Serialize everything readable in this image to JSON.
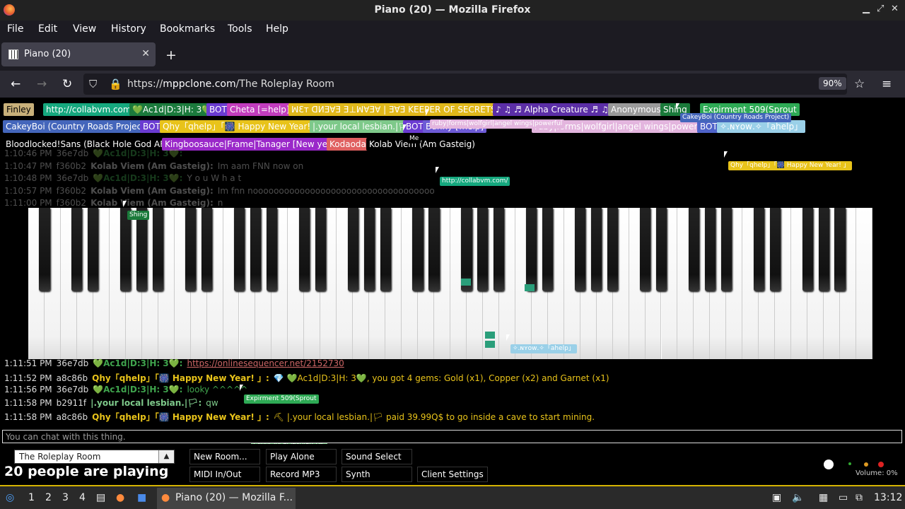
{
  "window": {
    "title": "Piano (20) — Mozilla Firefox"
  },
  "menu": [
    "File",
    "Edit",
    "View",
    "History",
    "Bookmarks",
    "Tools",
    "Help"
  ],
  "tab": {
    "label": "Piano (20)"
  },
  "nav": {
    "url_prefix": "https://",
    "url_host": "mppclone.com",
    "url_path": "/The Roleplay Room",
    "zoom": "90%"
  },
  "users_row1": [
    {
      "label": "Finley",
      "bg": "#c8b07a",
      "fg": "#000"
    },
    {
      "label": "http://collabvm.com/",
      "bg": "#15a87e",
      "fg": "#fff"
    },
    {
      "label": "💚Ac1d|D:3|H: 3💚",
      "bg": "#1b7a3c",
      "fg": "#fff"
    },
    {
      "label": "BOT",
      "bg": "#6a3bd1",
      "fg": "#fff"
    },
    {
      "label": "Cheta [=help]",
      "bg": "#c23cbd",
      "fg": "#fff"
    },
    {
      "label": "ꟽƐᴛ ᗡИƎ∀Ǝ Ǝ⊥ꟽ∀Ǝ∀ | ƎⱯƎ KEEPER OF SECRETS",
      "bg": "#e0b81a",
      "fg": "#fff"
    },
    {
      "label": "♪ ♫ ♬ Alpha Creature ♬ ♫",
      "bg": "#5b2ea6",
      "fg": "#fff"
    },
    {
      "label": "Anonymous",
      "bg": "#9a9a9a",
      "fg": "#fff"
    },
    {
      "label": "Shing",
      "bg": "#1a7a3a",
      "fg": "#fff"
    },
    {
      "label": "Expirment 509(Sprout",
      "bg": "#2eaa55",
      "fg": "#fff"
    }
  ],
  "users_row2": [
    {
      "label": "CakeyBoi (Country Roads Project)",
      "bg": "#4466bb",
      "fg": "#fff"
    },
    {
      "label": "BOT",
      "bg": "#6a3bd1",
      "fg": "#fff"
    },
    {
      "label": "Qhy「qhelp」「🎆 Happy New Year!」",
      "bg": "#e8c31a",
      "fg": "#fff"
    },
    {
      "label": "|.your local lesbian.|🏳",
      "bg": "#7ec98a",
      "fg": "#fff"
    },
    {
      "label": "BOT",
      "bg": "#6a3bd1",
      "fg": "#fff"
    },
    {
      "label": "Bunny [!help]",
      "bg": "#6d5bd6",
      "fg": "#fff"
    },
    {
      "label": "ruby|forms|wolfgirl|angel wings|powerful",
      "bg": "#e3b5de",
      "fg": "#fff"
    },
    {
      "label": "BOT",
      "bg": "#4f63c9",
      "fg": "#fff"
    },
    {
      "label": "✧.ɴʏᴏᴡ.✧「ahelp」",
      "bg": "#9ad0e8",
      "fg": "#fff"
    }
  ],
  "users_row3": [
    {
      "label": "Bloodlocked!Sans (Black Hole God AFK)",
      "bg": "#000",
      "fg": "#fff"
    },
    {
      "label": "Kingboosauce|Frame|Tanager [New year]",
      "bg": "#9a28c9",
      "fg": "#fff"
    },
    {
      "label": "Kodaoda",
      "bg": "#e06060",
      "fg": "#fff"
    },
    {
      "label": "Kolab Viem (Am Gasteig)",
      "bg": "#000",
      "fg": "#fff"
    }
  ],
  "chat_top": [
    {
      "time": "1:10:46 PM",
      "id": "36e7db",
      "name": "💚Ac1d|D:3|H: 3💚:",
      "msg": "",
      "color": "#3fa34d"
    },
    {
      "time": "1:10:47 PM",
      "id": "f360b2",
      "name": "Kolab Viem (Am Gasteig):",
      "msg": "Im aam FNN now on",
      "color": "#ddd"
    },
    {
      "time": "1:10:48 PM",
      "id": "36e7db",
      "name": "💚Ac1d|D:3|H: 3💚:",
      "msg": "Y o u W h a t",
      "color": "#3fa34d"
    },
    {
      "time": "1:10:57 PM",
      "id": "f360b2",
      "name": "Kolab Viem (Am Gasteig):",
      "msg": "Im fnn nooooooooooooooooooooooooooooooooooo",
      "color": "#ddd"
    },
    {
      "time": "1:11:00 PM",
      "id": "f360b2",
      "name": "Kolab Viem (Am Gasteig):",
      "msg": "n",
      "color": "#ddd"
    }
  ],
  "chat_bottom": [
    {
      "time": "1:11:51 PM",
      "id": "36e7db",
      "name": "💚Ac1d|D:3|H: 3💚:",
      "msg": "https://onlinesequencer.net/2152730",
      "color": "#3fa34d",
      "msgcolor": "#c66"
    },
    {
      "time": "1:11:52 PM",
      "id": "a8c86b",
      "name": "Qhy「qhelp」「🎆 Happy New Year! 」:",
      "msg": "💎 💚Ac1d|D:3|H: 3💚, you got 4 gems: Gold (x1), Copper (x2) and Garnet (x1)",
      "color": "#e8c31a",
      "msgcolor": "#e8c31a"
    },
    {
      "time": "1:11:56 PM",
      "id": "36e7db",
      "name": "💚Ac1d|D:3|H: 3💚:",
      "msg": "looky ^^^^^",
      "color": "#3fa34d",
      "msgcolor": "#3fa34d"
    },
    {
      "time": "1:11:58 PM",
      "id": "b2911f",
      "name": "|.your local lesbian.|🏳:",
      "msg": "qw",
      "color": "#7ec98a",
      "msgcolor": "#7ec98a"
    },
    {
      "time": "1:11:58 PM",
      "id": "a8c86b",
      "name": "Qhy「qhelp」「🎆 Happy New Year! 」:",
      "msg": "⛏ |.your local lesbian.|🏳 paid 39.99Q$ to go inside a cave to start mining.",
      "color": "#e8c31a",
      "msgcolor": "#e8c31a"
    }
  ],
  "cursor_labels": [
    {
      "label": "CakeyBoi (Country Roads Project)",
      "bg": "#4466bb"
    },
    {
      "label": "Qhy「qhelp」「🎆 Happy New Year! 」",
      "bg": "#e8c31a"
    },
    {
      "label": "http://collabvm.com/",
      "bg": "#15a87e"
    },
    {
      "label": "Shing",
      "bg": "#1a7a3a"
    },
    {
      "label": "✧.ɴʏᴏᴡ.✧「ahelp」",
      "bg": "#9ad0e8"
    },
    {
      "label": "Expirment 509(Sprout",
      "bg": "#2eaa55"
    },
    {
      "label": "|.your local lesbian.|🏳",
      "bg": "#7ec98a"
    },
    {
      "label": "Kodaoda",
      "bg": "#e06060"
    },
    {
      "label": "ruby|forms|wolfgirl|angel wings|powerful",
      "bg": "#e3b5de"
    },
    {
      "label": "Me",
      "bg": "#000"
    }
  ],
  "chat_input": {
    "placeholder": "You can chat with this thing."
  },
  "room": {
    "name": "The Roleplay Room",
    "count": "20",
    "playing_suffix": "people are playing"
  },
  "buttons": {
    "new_room": "New Room...",
    "play_alone": "Play Alone",
    "sound_select": "Sound Select",
    "midi": "MIDI In/Out",
    "record": "Record MP3",
    "synth": "Synth",
    "client_settings": "Client Settings"
  },
  "volume": {
    "label": "Volume: 0%",
    "level": 0
  },
  "taskbar": {
    "workspaces": [
      "1",
      "2",
      "3",
      "4"
    ],
    "window_label": "Piano (20) — Mozilla F...",
    "clock": "13:12"
  },
  "colors": {
    "accent": "#d4b300",
    "chrome": "#2b2a33"
  }
}
